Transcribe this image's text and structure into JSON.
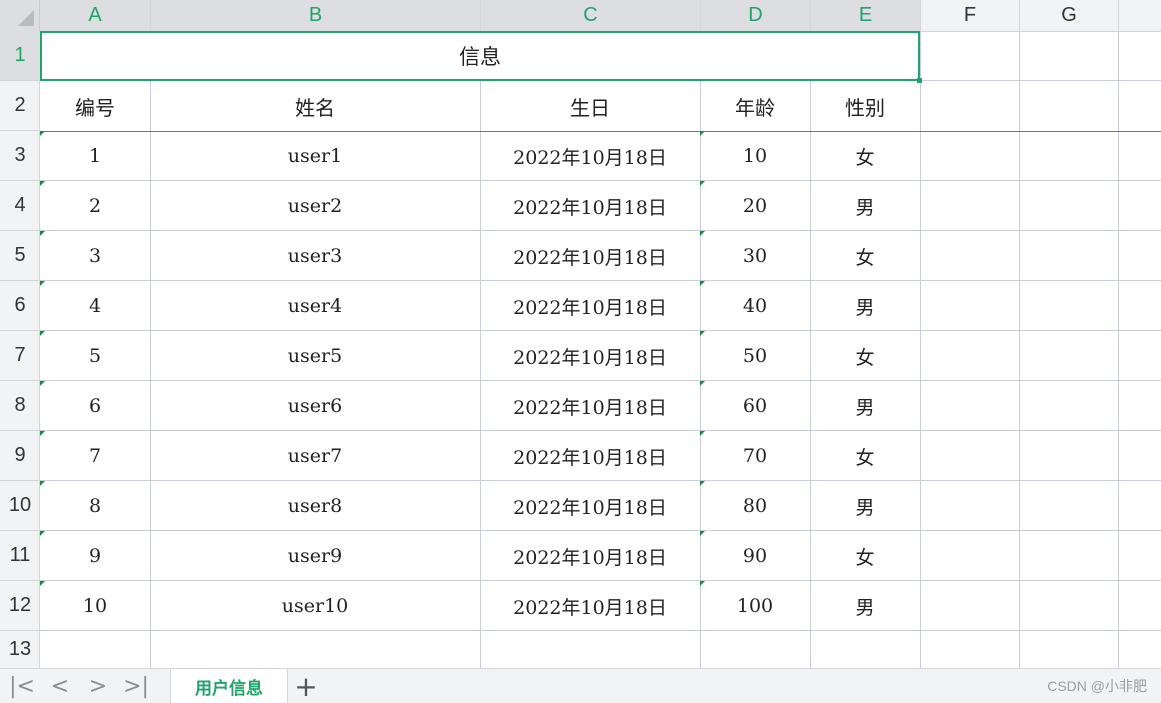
{
  "columns": [
    "A",
    "B",
    "C",
    "D",
    "E",
    "F",
    "G"
  ],
  "rows": [
    "1",
    "2",
    "3",
    "4",
    "5",
    "6",
    "7",
    "8",
    "9",
    "10",
    "11",
    "12",
    "13"
  ],
  "title": "信息",
  "headers": [
    "编号",
    "姓名",
    "生日",
    "年龄",
    "性别"
  ],
  "records": [
    [
      "1",
      "user1",
      "2022年10月18日",
      "10",
      "女"
    ],
    [
      "2",
      "user2",
      "2022年10月18日",
      "20",
      "男"
    ],
    [
      "3",
      "user3",
      "2022年10月18日",
      "30",
      "女"
    ],
    [
      "4",
      "user4",
      "2022年10月18日",
      "40",
      "男"
    ],
    [
      "5",
      "user5",
      "2022年10月18日",
      "50",
      "女"
    ],
    [
      "6",
      "user6",
      "2022年10月18日",
      "60",
      "男"
    ],
    [
      "7",
      "user7",
      "2022年10月18日",
      "70",
      "女"
    ],
    [
      "8",
      "user8",
      "2022年10月18日",
      "80",
      "男"
    ],
    [
      "9",
      "user9",
      "2022年10月18日",
      "90",
      "女"
    ],
    [
      "10",
      "user10",
      "2022年10月18日",
      "100",
      "男"
    ]
  ],
  "sheet_tab": "用户信息",
  "add_sheet": "+",
  "nav": {
    "first": "|<",
    "prev": "<",
    "next": ">",
    "last": ">|"
  },
  "watermark": "CSDN @小非肥",
  "colors": {
    "accent": "#1fa46a",
    "header_bg": "#f2f3f5",
    "grid_line": "#c9cdda"
  }
}
